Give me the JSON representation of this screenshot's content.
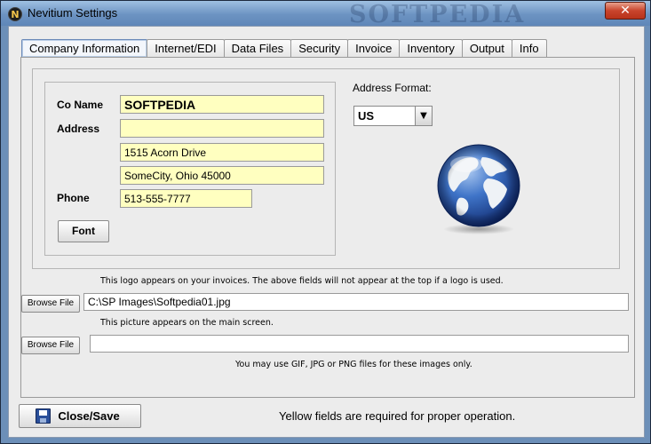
{
  "window": {
    "title": "Nevitium Settings",
    "app_icon_letter": "N",
    "watermark": "SOFTPEDIA",
    "close_glyph": "✕"
  },
  "tabs": [
    {
      "label": "Company Information",
      "active": true
    },
    {
      "label": "Internet/EDI",
      "active": false
    },
    {
      "label": "Data Files",
      "active": false
    },
    {
      "label": "Security",
      "active": false
    },
    {
      "label": "Invoice",
      "active": false
    },
    {
      "label": "Inventory",
      "active": false
    },
    {
      "label": "Output",
      "active": false
    },
    {
      "label": "Info",
      "active": false
    }
  ],
  "company": {
    "co_name_label": "Co Name",
    "co_name_value": "SOFTPEDIA",
    "address_label": "Address",
    "address_line1": "",
    "address_line2": "1515 Acorn Drive",
    "address_line3": "SomeCity, Ohio 45000",
    "phone_label": "Phone",
    "phone_value": "513-555-7777",
    "font_button": "Font"
  },
  "address_format": {
    "label": "Address Format:",
    "selected": "US"
  },
  "images": {
    "logo_note": "This logo appears on your invoices.  The above fields will not appear at the top if a logo is used.",
    "browse_logo_label": "Browse File",
    "logo_path": "C:\\SP Images\\Softpedia01.jpg",
    "picture_note": "This picture appears on the main screen.",
    "browse_picture_label": "Browse File",
    "picture_path": "",
    "formats_note": "You may use GIF, JPG or PNG files for these images only."
  },
  "footer": {
    "close_save_label": "Close/Save",
    "status_message": "Yellow fields are required for proper operation."
  },
  "colors": {
    "required_field": "#ffffc0",
    "titlebar": "#6c93c2"
  }
}
